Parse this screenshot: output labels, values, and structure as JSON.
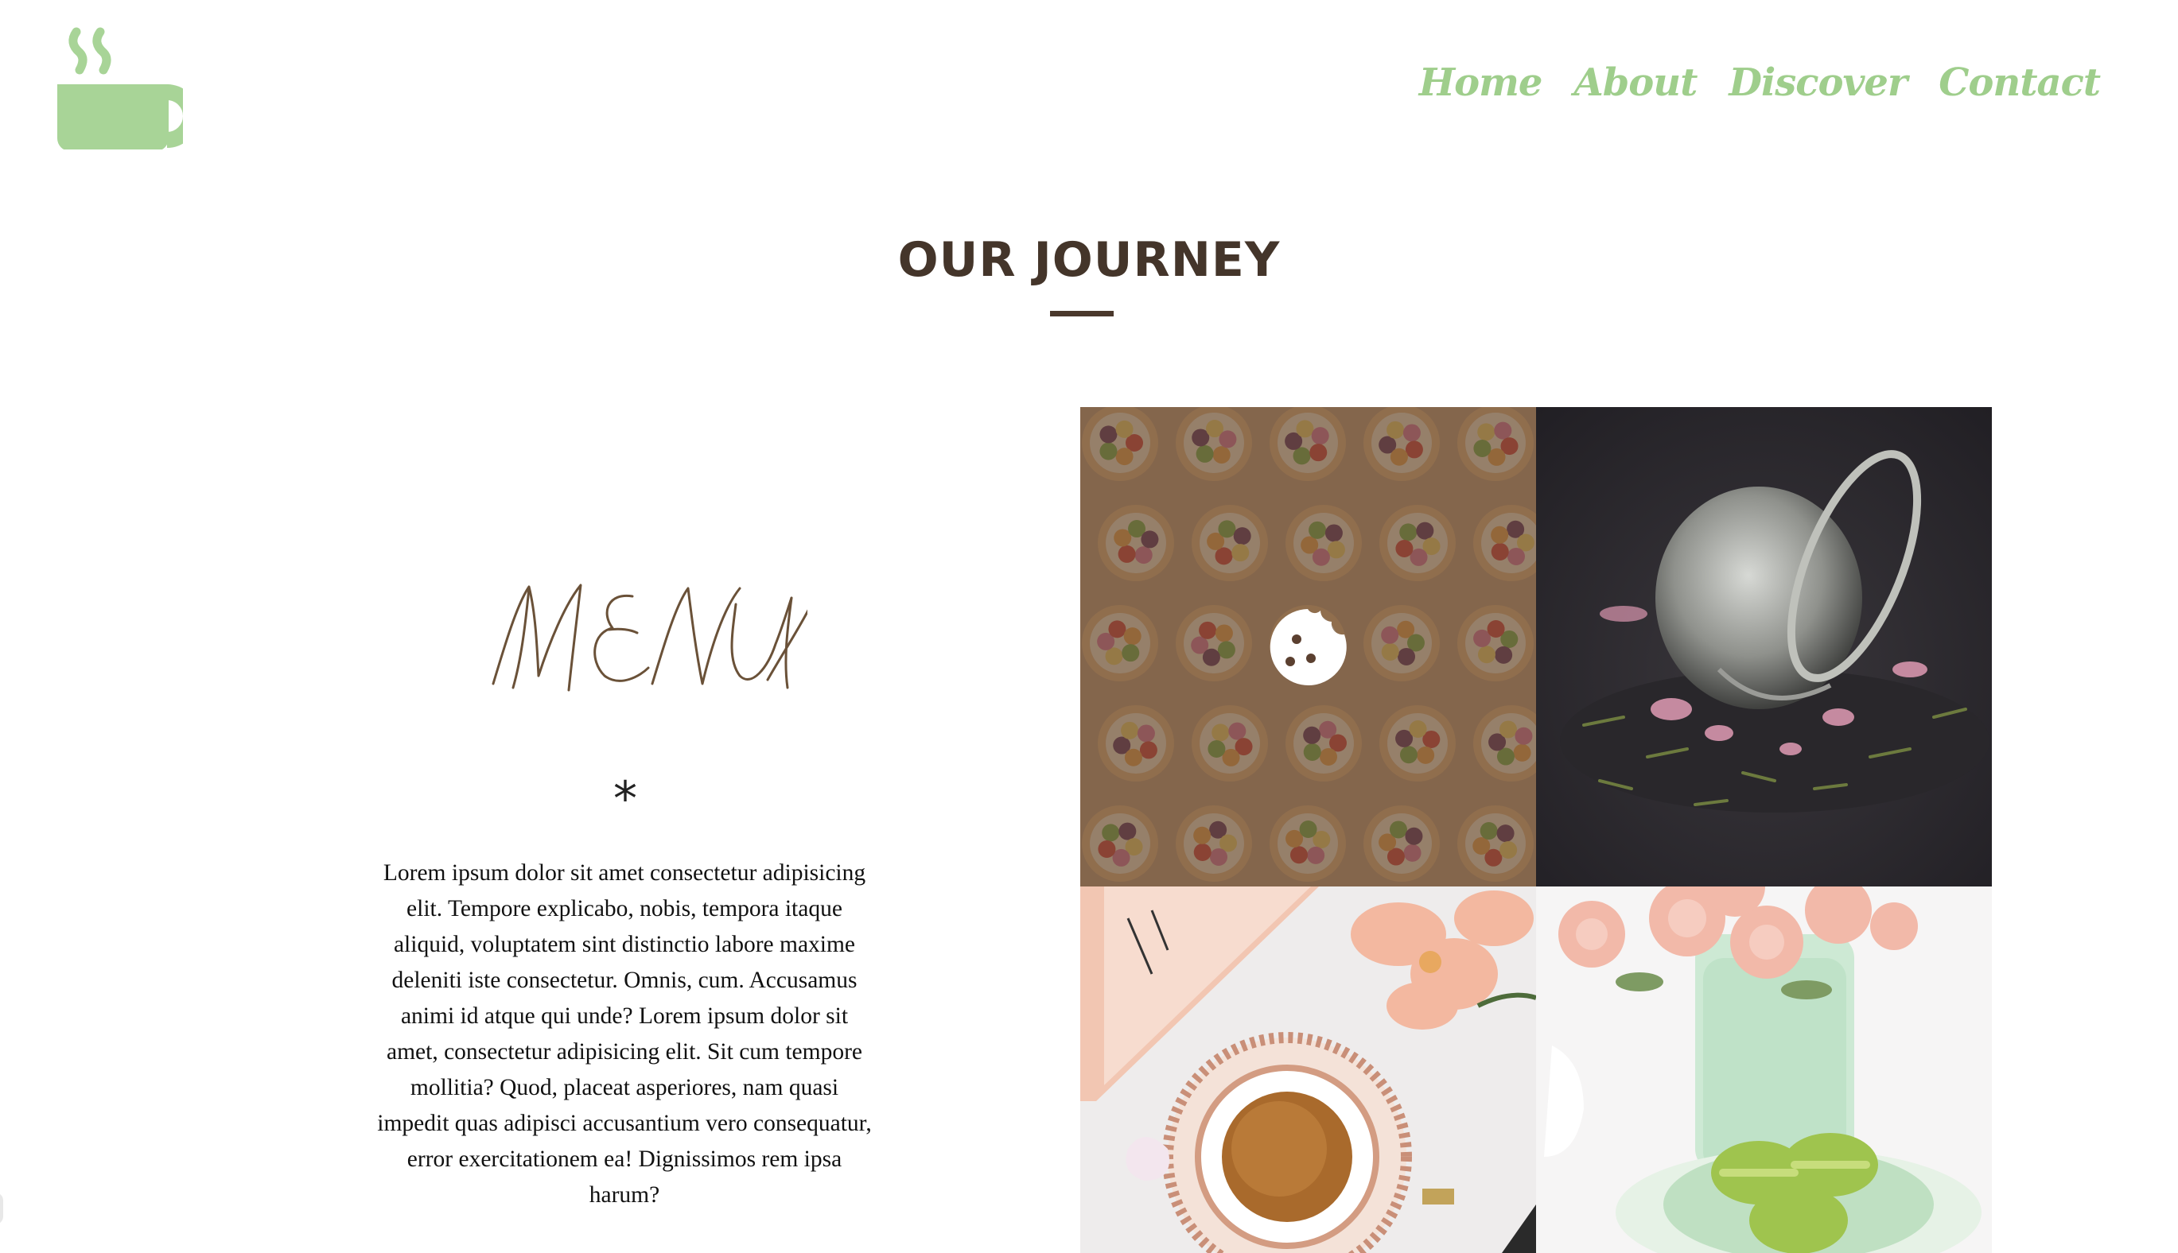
{
  "header": {
    "logo_icon": "coffee-cup-icon",
    "brand_color": "#a8d497",
    "nav": [
      {
        "label": "Home"
      },
      {
        "label": "About"
      },
      {
        "label": "Discover"
      },
      {
        "label": "Contact"
      }
    ]
  },
  "section": {
    "title": "OUR JOURNEY"
  },
  "menu": {
    "heading": "MENU",
    "divider_glyph": "*",
    "description": "Lorem ipsum dolor sit amet consectetur adipisicing elit. Tempore explicabo, nobis, tempora itaque aliquid, voluptatem sint distinctio labore maxime deleniti iste consectetur. Omnis, cum. Accusamus animi id atque qui unde? Lorem ipsum dolor sit amet, consectetur adipisicing elit. Sit cum tempore mollitia? Quod, placeat asperiores, nam quasi impedit quas adipisci accusantium vero consequatur, error exercitationem ea! Dignissimos rem ipsa harum?"
  },
  "gallery": {
    "overlay_icon": "cookie-icon",
    "accent_brown": "#4a382c"
  }
}
